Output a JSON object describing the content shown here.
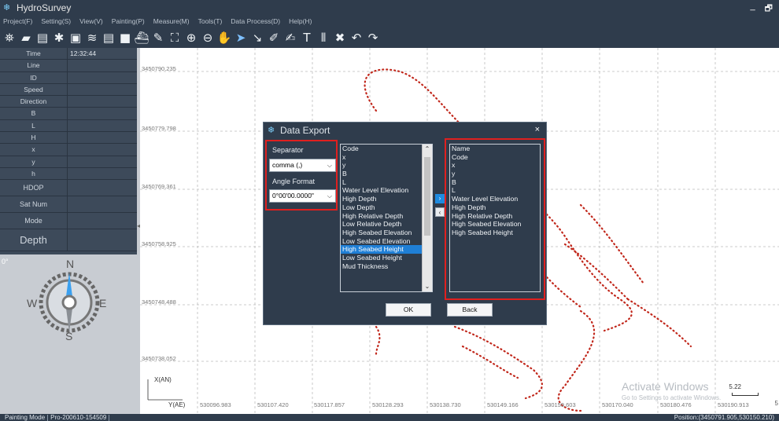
{
  "app": {
    "title": "HydroSurvey",
    "minimize_glyph": "_",
    "restore_glyph": "🗗"
  },
  "menu": [
    "Project(F)",
    "Setting(S)",
    "View(V)",
    "Painting(P)",
    "Measure(M)",
    "Tools(T)",
    "Data Process(D)",
    "Help(H)"
  ],
  "toolbar_icons": [
    {
      "name": "satellite-icon",
      "glyph": "⛯"
    },
    {
      "name": "open-folder-icon",
      "glyph": "▰"
    },
    {
      "name": "save-icon",
      "glyph": "▤"
    },
    {
      "name": "settings-gear-icon",
      "glyph": "✱"
    },
    {
      "name": "image-icon",
      "glyph": "▣"
    },
    {
      "name": "wave-icon",
      "glyph": "≋"
    },
    {
      "name": "document-icon",
      "glyph": "▤"
    },
    {
      "name": "video-icon",
      "glyph": "■"
    },
    {
      "name": "ship-icon",
      "glyph": "⛴"
    },
    {
      "name": "edit-icon",
      "glyph": "✎"
    },
    {
      "name": "fit-extent-icon",
      "glyph": "⛶"
    },
    {
      "name": "zoom-in-icon",
      "glyph": "⊕"
    },
    {
      "name": "zoom-out-icon",
      "glyph": "⊖"
    },
    {
      "name": "pan-hand-icon",
      "glyph": "✋"
    },
    {
      "name": "select-arrow-icon",
      "glyph": "➤"
    },
    {
      "name": "draw-line-icon",
      "glyph": "↘"
    },
    {
      "name": "edit-point-icon",
      "glyph": "✐"
    },
    {
      "name": "sign-icon",
      "glyph": "✍"
    },
    {
      "name": "text-icon",
      "glyph": "T"
    },
    {
      "name": "barcode-icon",
      "glyph": "⦀"
    },
    {
      "name": "delete-x-icon",
      "glyph": "✖"
    },
    {
      "name": "undo-icon",
      "glyph": "↶"
    },
    {
      "name": "redo-icon",
      "glyph": "↷"
    }
  ],
  "info_panel": {
    "rows": [
      {
        "label": "Time",
        "value": "12:32:44"
      },
      {
        "label": "Line",
        "value": ""
      },
      {
        "label": "ID",
        "value": ""
      },
      {
        "label": "Speed",
        "value": ""
      },
      {
        "label": "Direction",
        "value": ""
      },
      {
        "label": "B",
        "value": ""
      },
      {
        "label": "L",
        "value": ""
      },
      {
        "label": "H",
        "value": ""
      },
      {
        "label": "x",
        "value": ""
      },
      {
        "label": "y",
        "value": ""
      },
      {
        "label": "h",
        "value": ""
      }
    ],
    "big_rows": [
      {
        "label": "HDOP",
        "value": ""
      },
      {
        "label": "Sat Num",
        "value": ""
      },
      {
        "label": "Mode",
        "value": ""
      }
    ],
    "depth": {
      "label": "Depth",
      "value": ""
    }
  },
  "compass": {
    "degree": "0°",
    "n": "N",
    "s": "S",
    "e": "E",
    "w": "W"
  },
  "map": {
    "y_labels": [
      "3450790.235",
      "3450779.798",
      "3450769.361",
      "3450758.925",
      "3450748.488",
      "3450738.052"
    ],
    "x_labels": [
      "530096.983",
      "530107.420",
      "530117.857",
      "530128.293",
      "530138.730",
      "530149.166",
      "530159.603",
      "530170.040",
      "530180.476",
      "530190.913"
    ],
    "x_axis_tag": "Y(AE)",
    "y_axis_tag": "X(AN)",
    "scale_value": "5.22",
    "edge_char": "5",
    "watermark_title": "Activate Windows",
    "watermark_sub": "Go to Settings to activate Windows."
  },
  "status": {
    "mode": "Painting Mode",
    "project": "Pro-200610-154509",
    "position": "Position:(3450791.905,530150.210)"
  },
  "dialog": {
    "title": "Data Export",
    "separator_label": "Separator",
    "separator_value": "comma  (,)",
    "angle_label": "Angle Format",
    "angle_value": "0°00'00.0000\"",
    "available_fields": [
      "Code",
      "x",
      "y",
      "B",
      "L",
      "Water Level Elevation",
      "High Depth",
      "Low Depth",
      "High Relative Depth",
      "Low Relative Depth",
      "High Seabed Elevation",
      "Low Seabed Elevation",
      "High Seabed Height",
      "Low Seabed Height",
      "Mud Thickness"
    ],
    "selected_available": "High Seabed Height",
    "export_fields": [
      "Name",
      "Code",
      "x",
      "y",
      "B",
      "L",
      "Water Level Elevation",
      "High Depth",
      "High Relative Depth",
      "High Seabed Elevation",
      "High Seabed Height"
    ],
    "add_glyph": "›",
    "remove_glyph": "‹",
    "ok_label": "OK",
    "back_label": "Back"
  }
}
